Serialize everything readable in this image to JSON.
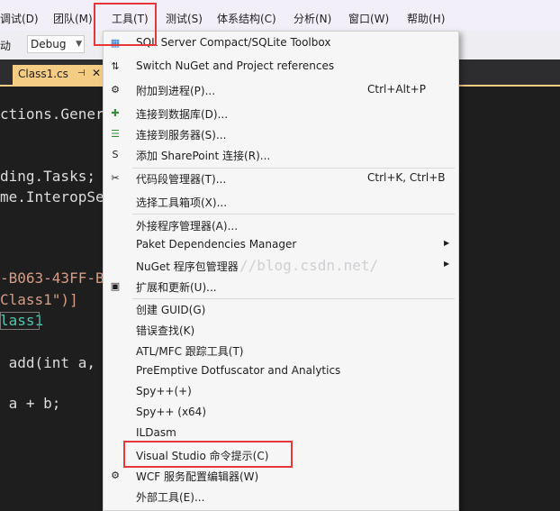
{
  "menubar": {
    "items": [
      "调试(D)",
      "团队(M)",
      "工具(T)",
      "测试(S)",
      "体系结构(C)",
      "分析(N)",
      "窗口(W)",
      "帮助(H)"
    ]
  },
  "toolbar": {
    "partial_label": "动",
    "config_value": "Debug"
  },
  "tab": {
    "label": "Class1.cs",
    "pin": "⊣",
    "close": "✕"
  },
  "code": {
    "lines": [
      "ctions.Gener",
      "ding.Tasks;",
      "me.InteropSer",
      "-B063-43FF-B",
      "Class1\")]",
      "lass1",
      " add(int a,",
      " a + b;"
    ]
  },
  "tools_menu": {
    "items": [
      {
        "icon": "database-icon",
        "glyph": "▦",
        "label": "SQL Server Compact/SQLite Toolbox",
        "shortcut": ""
      },
      {
        "icon": "nuget-switch-icon",
        "glyph": "⇅",
        "label": "Switch NuGet and Project references",
        "shortcut": ""
      },
      {
        "icon": "attach-process-icon",
        "glyph": "⚙",
        "label": "附加到进程(P)...",
        "shortcut": "Ctrl+Alt+P"
      },
      {
        "icon": "connect-database-icon",
        "glyph": "✚",
        "label": "连接到数据库(D)...",
        "shortcut": ""
      },
      {
        "icon": "connect-server-icon",
        "glyph": "☰",
        "label": "连接到服务器(S)...",
        "shortcut": ""
      },
      {
        "icon": "sharepoint-icon",
        "glyph": "S",
        "label": "添加 SharePoint 连接(R)...",
        "shortcut": ""
      },
      {
        "icon": "snippet-manager-icon",
        "glyph": "✂",
        "label": "代码段管理器(T)...",
        "shortcut": "Ctrl+K, Ctrl+B"
      },
      {
        "icon": "",
        "glyph": "",
        "label": "选择工具箱项(X)...",
        "shortcut": ""
      },
      {
        "icon": "",
        "glyph": "",
        "label": "外接程序管理器(A)...",
        "shortcut": ""
      },
      {
        "icon": "",
        "glyph": "",
        "label": "Paket Dependencies Manager",
        "shortcut": "",
        "submenu": true
      },
      {
        "icon": "",
        "glyph": "",
        "label": "NuGet 程序包管理器",
        "shortcut": "",
        "submenu": true
      },
      {
        "icon": "extensions-icon",
        "glyph": "▣",
        "label": "扩展和更新(U)...",
        "shortcut": ""
      },
      {
        "icon": "",
        "glyph": "",
        "label": "创建 GUID(G)",
        "shortcut": ""
      },
      {
        "icon": "",
        "glyph": "",
        "label": "错误查找(K)",
        "shortcut": ""
      },
      {
        "icon": "",
        "glyph": "",
        "label": "ATL/MFC 跟踪工具(T)",
        "shortcut": ""
      },
      {
        "icon": "",
        "glyph": "",
        "label": "PreEmptive Dotfuscator and Analytics",
        "shortcut": ""
      },
      {
        "icon": "",
        "glyph": "",
        "label": "Spy++(+)",
        "shortcut": ""
      },
      {
        "icon": "",
        "glyph": "",
        "label": "Spy++ (x64)",
        "shortcut": ""
      },
      {
        "icon": "",
        "glyph": "",
        "label": "ILDasm",
        "shortcut": ""
      },
      {
        "icon": "",
        "glyph": "",
        "label": "Visual Studio 命令提示(C)",
        "shortcut": ""
      },
      {
        "icon": "wcf-editor-icon",
        "glyph": "⚙",
        "label": "WCF 服务配置编辑器(W)",
        "shortcut": ""
      },
      {
        "icon": "",
        "glyph": "",
        "label": "外部工具(E)...",
        "shortcut": ""
      }
    ]
  },
  "watermark": "//blog.csdn.net/",
  "colors": {
    "highlight": "#e5383b",
    "menu_bg": "#f6f6f6",
    "editor_bg": "#1e1e1e",
    "tab_active": "#f5cc84"
  }
}
